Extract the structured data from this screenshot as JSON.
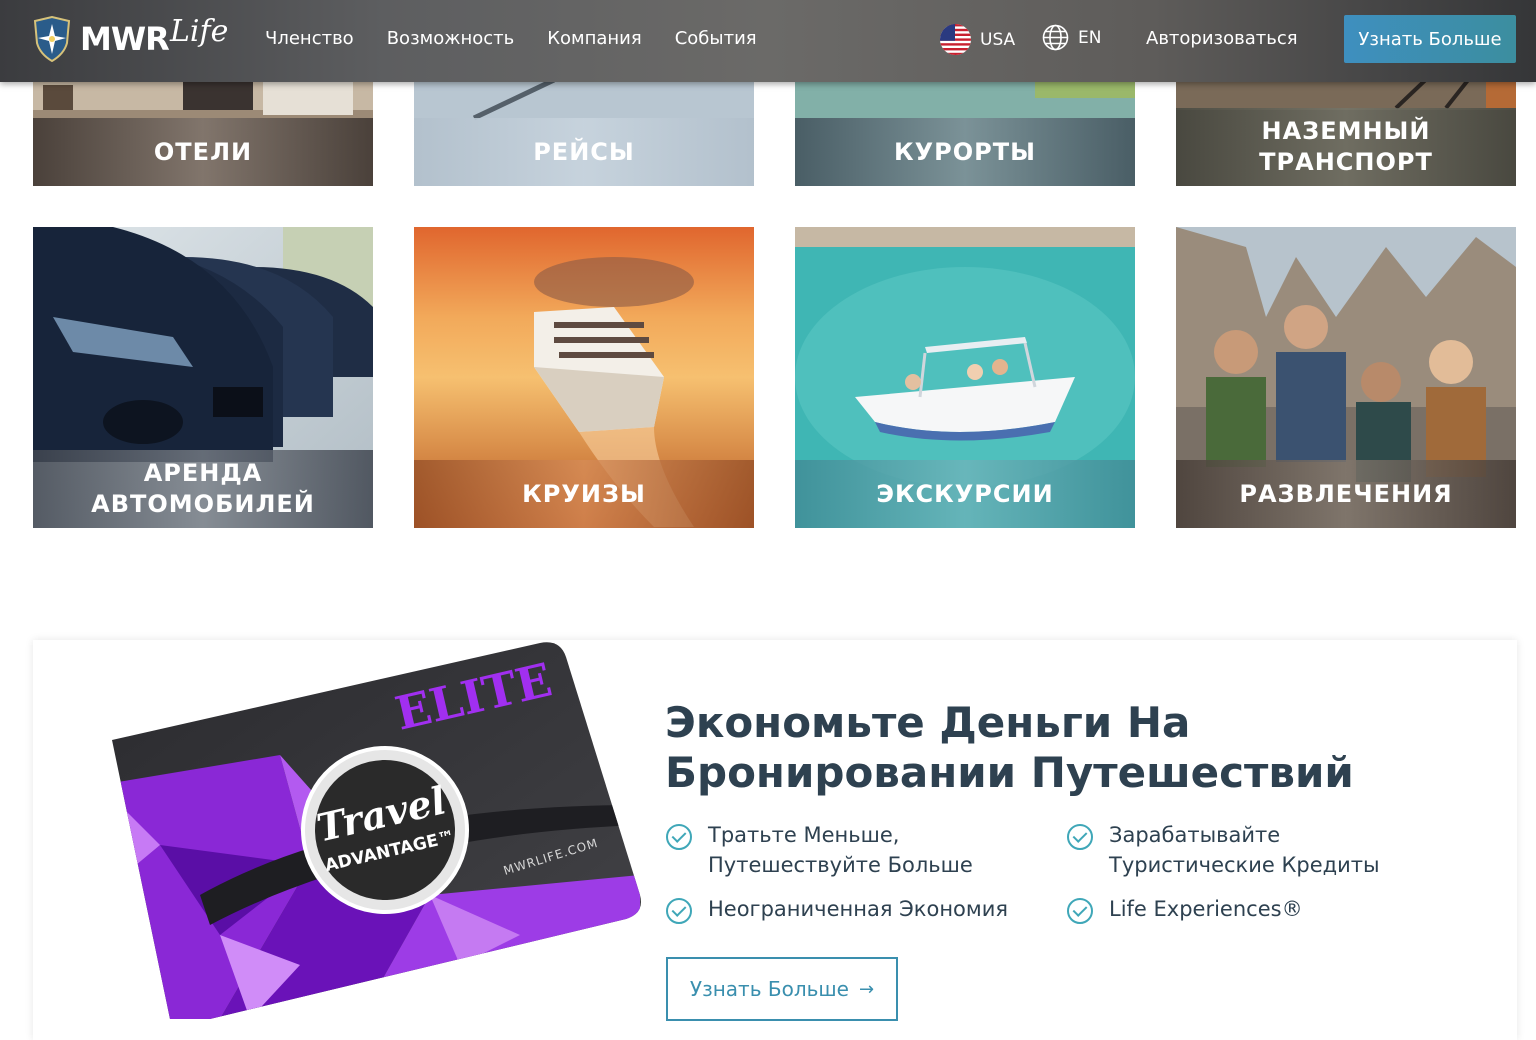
{
  "header": {
    "logo_text": "MWR",
    "logo_script": "Life",
    "nav": [
      "Членство",
      "Возможность",
      "Компания",
      "События"
    ],
    "country": "USA",
    "language": "EN",
    "login": "Авторизоваться",
    "cta": "Узнать Больше"
  },
  "tiles_row1": [
    {
      "label": "ОТЕЛИ",
      "photo": "hotel-lobby"
    },
    {
      "label": "РЕЙСЫ",
      "photo": "airplane-sky"
    },
    {
      "label": "КУРОРТЫ",
      "photo": "resort-pool"
    },
    {
      "label": "НАЗЕМНЫЙ ТРАНСПОРТ",
      "photo": "railway"
    }
  ],
  "tiles_row2": [
    {
      "label": "АРЕНДА АВТОМОБИЛЕЙ",
      "photo": "parked-cars"
    },
    {
      "label": "КРУИЗЫ",
      "photo": "cruise-ship-sunset"
    },
    {
      "label": "ЭКСКУРСИИ",
      "photo": "boat-turquoise-sea"
    },
    {
      "label": "РАЗВЛЕЧЕНИЯ",
      "photo": "friends-hiking"
    }
  ],
  "promo": {
    "title": "Экономьте Деньги На Бронировании Путешествий",
    "features": [
      "Тратьте Меньше,\nПутешествуйте Больше",
      "Зарабатывайте\nТуристические Кредиты",
      "Неограниченная Экономия",
      "Life Experiences®"
    ],
    "cta": "Узнать Больше",
    "cta_arrow": "→",
    "card": {
      "tier": "ELITE",
      "badge_line1": "Travel",
      "badge_line2": "ADVANTAGE™",
      "url": "MWRLIFE.COM"
    }
  },
  "colors": {
    "accent": "#3fa7b8",
    "cta_blue": "#3e8fbf",
    "title": "#2e4150",
    "card_purple": "#9b2fe0"
  }
}
